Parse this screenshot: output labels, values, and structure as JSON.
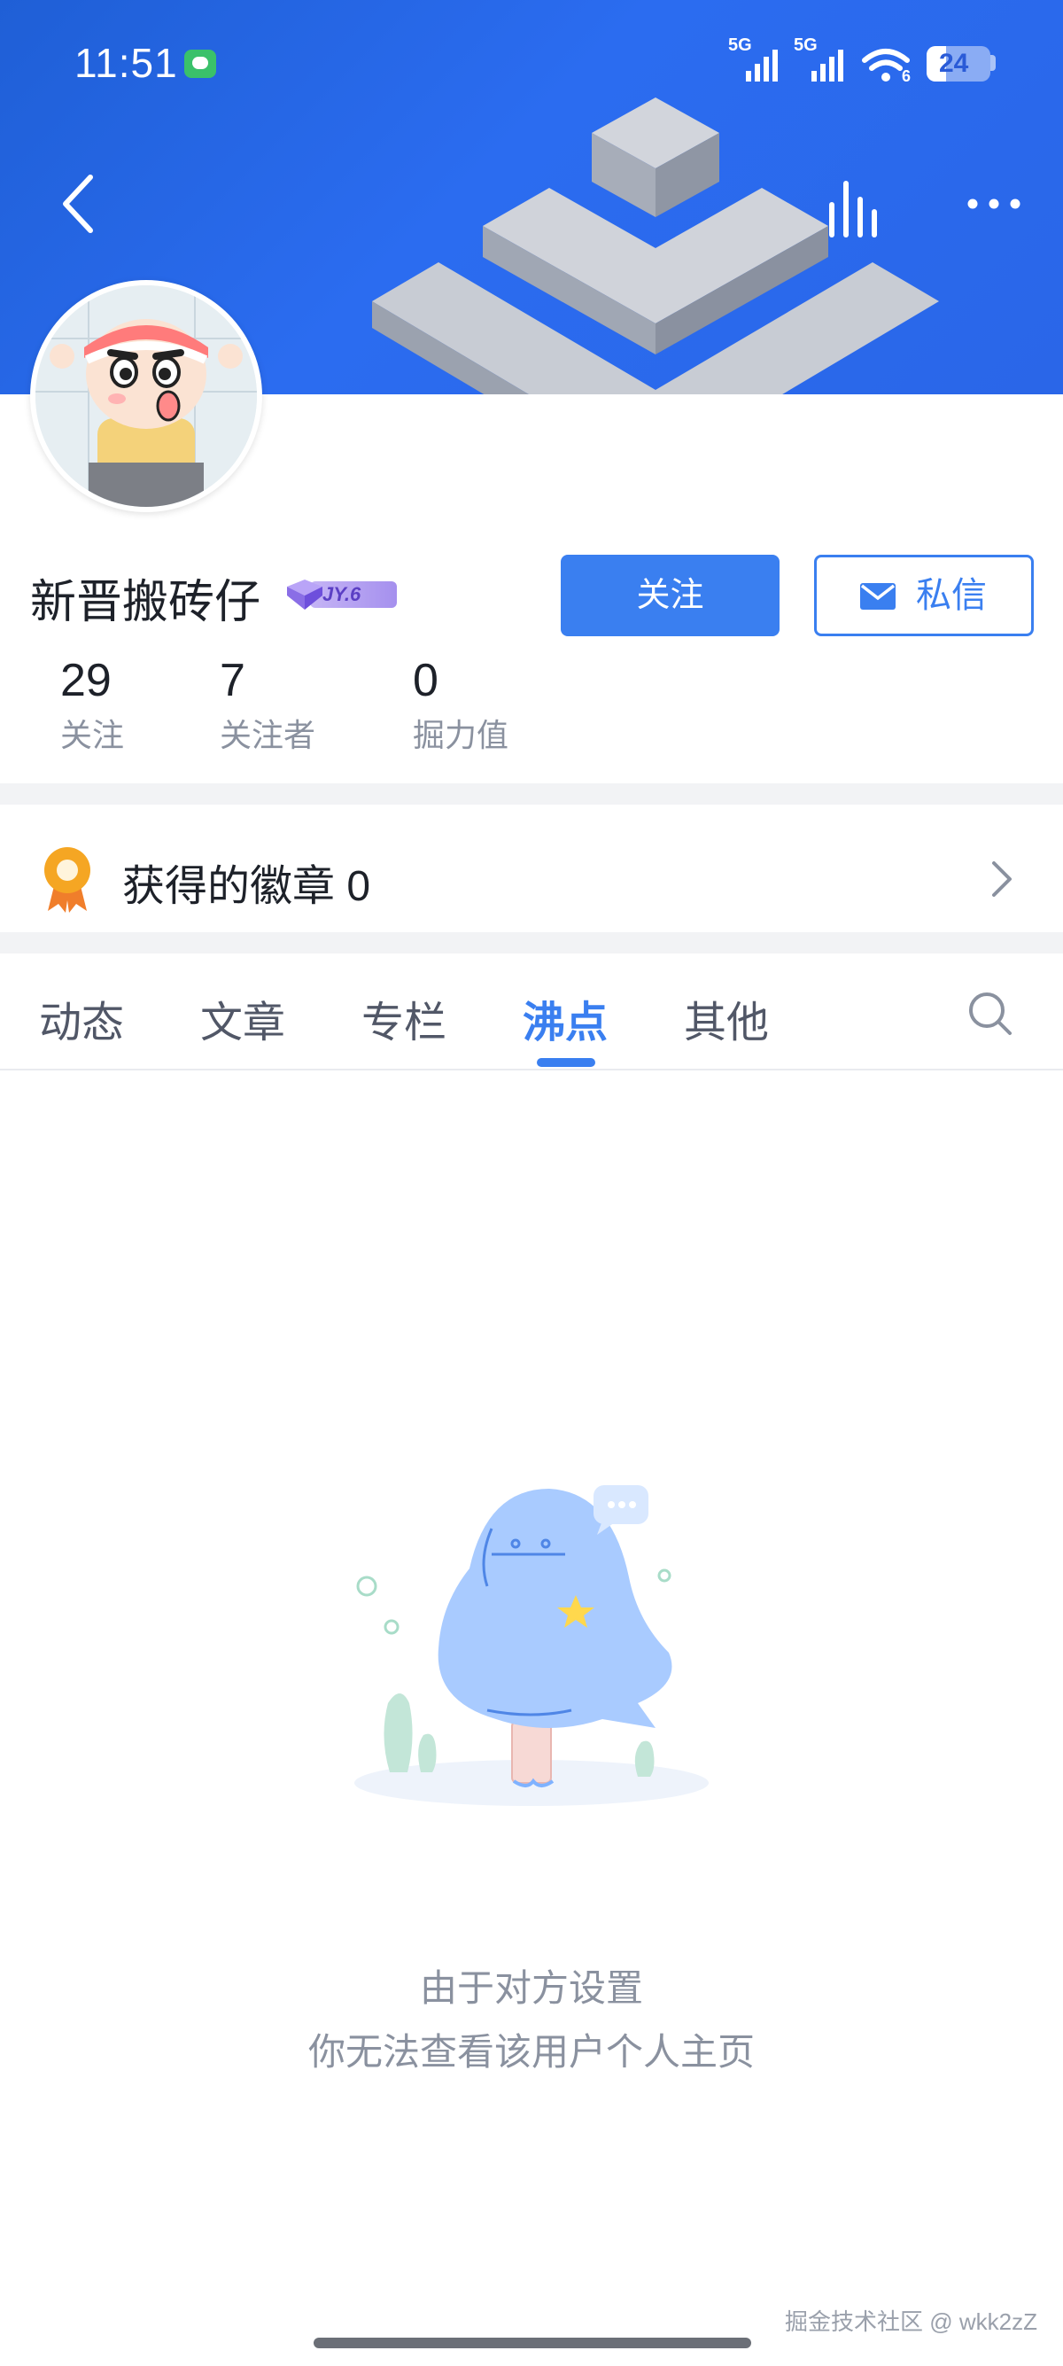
{
  "status_bar": {
    "time": "11:51",
    "signal1_label": "5G",
    "signal2_label": "5G",
    "wifi_sub": "6",
    "battery": "24"
  },
  "profile": {
    "name": "新晋搬砖仔",
    "level": "JY.6",
    "follow_button": "关注",
    "message_button": "私信",
    "stats": [
      {
        "value": "29",
        "label": "关注"
      },
      {
        "value": "7",
        "label": "关注者"
      },
      {
        "value": "0",
        "label": "掘力值"
      }
    ]
  },
  "badges": {
    "label": "获得的徽章 0"
  },
  "tabs": [
    {
      "label": "动态"
    },
    {
      "label": "文章"
    },
    {
      "label": "专栏"
    },
    {
      "label": "沸点",
      "active": true
    },
    {
      "label": "其他"
    }
  ],
  "empty_state": {
    "line1": "由于对方设置",
    "line2": "你无法查看该用户个人主页"
  },
  "watermark": "掘金技术社区 @ wkk2zZ",
  "colors": {
    "accent": "#3a7ff0",
    "banner": "#2a66e8",
    "muted_text": "#8a919f"
  }
}
